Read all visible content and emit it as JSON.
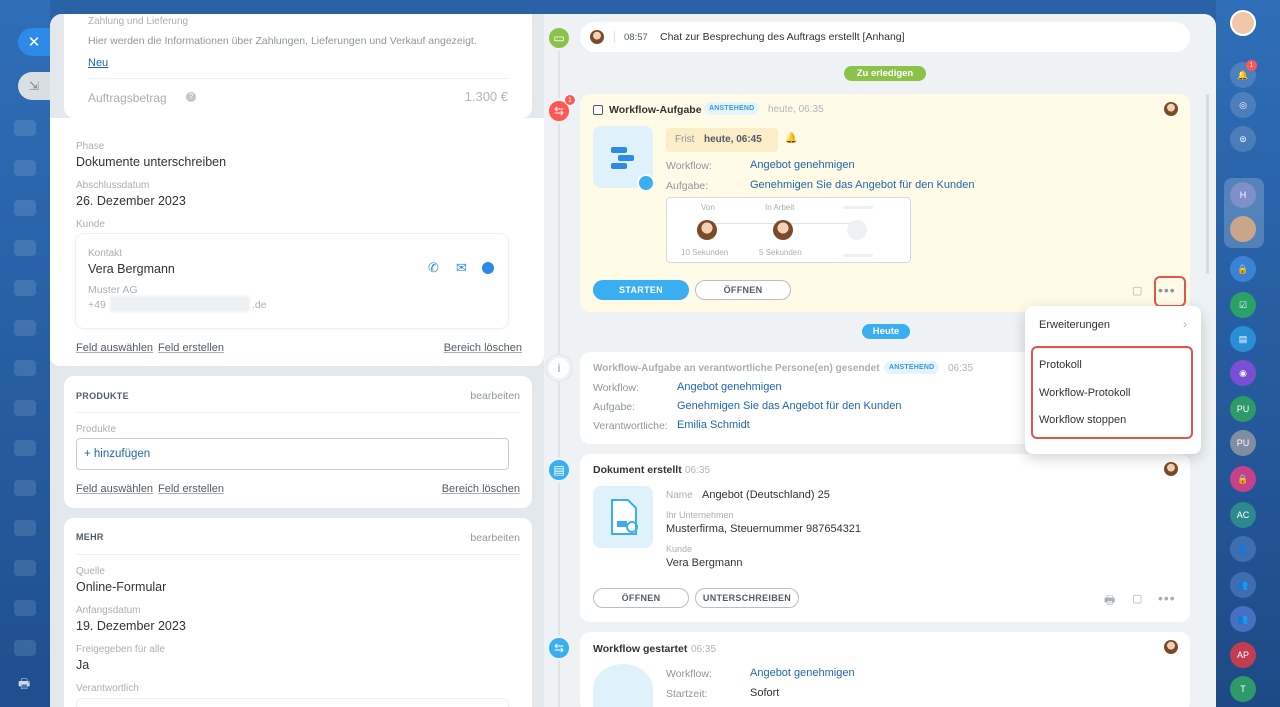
{
  "left_panel": {
    "payment": {
      "title": "Zahlung und Lieferung",
      "description": "Hier werden die Informationen über Zahlungen, Lieferungen und Verkauf angezeigt.",
      "new_link": "Neu",
      "amount_label": "Auftragsbetrag",
      "amount_value": "1.300 €"
    },
    "fields": {
      "phase_label": "Phase",
      "phase_value": "Dokumente unterschreiben",
      "close_date_label": "Abschlussdatum",
      "close_date_value": "26. Dezember 2023",
      "customer_label": "Kunde",
      "contact_label": "Kontakt",
      "contact_name": "Vera Bergmann",
      "company": "Muster AG",
      "phone_prefix": "+49",
      "email_suffix": ".de"
    },
    "actions": {
      "select_field": "Feld auswählen",
      "create_field": "Feld erstellen",
      "delete_section": "Bereich löschen"
    },
    "products": {
      "title": "PRODUKTE",
      "edit": "bearbeiten",
      "label": "Produkte",
      "add": "+ hinzufügen"
    },
    "more": {
      "title": "MEHR",
      "edit": "bearbeiten",
      "source_label": "Quelle",
      "source_value": "Online-Formular",
      "start_label": "Anfangsdatum",
      "start_value": "19. Dezember 2023",
      "shared_label": "Freigegeben für alle",
      "shared_value": "Ja",
      "responsible_label": "Verantwortlich"
    }
  },
  "timeline": {
    "chat": {
      "time": "08:57",
      "text": "Chat zur Besprechung des Auftrags erstellt [Anhang]"
    },
    "todo_pill": "Zu erledigen",
    "today_pill": "Heute",
    "workflow_task": {
      "badge_count": "1",
      "title": "Workflow-Aufgabe",
      "status": "ANSTEHEND",
      "time": "heute, 06:35",
      "deadline_label": "Frist",
      "deadline_value": "heute, 06:45",
      "workflow_label": "Workflow:",
      "workflow_value": "Angebot genehmigen",
      "task_label": "Aufgabe:",
      "task_value": "Genehmigen Sie das Angebot für den Kunden",
      "from_label": "Von",
      "in_progress_label": "In Arbeit",
      "from_time": "10 Sekunden",
      "progress_time": "5 Sekunden",
      "start_button": "STARTEN",
      "open_button": "ÖFFNEN"
    },
    "sent_task": {
      "title": "Workflow-Aufgabe an verantwortliche Persone(en) gesendet",
      "status": "ANSTEHEND",
      "time": "06:35",
      "workflow_label": "Workflow:",
      "workflow_value": "Angebot genehmigen",
      "task_label": "Aufgabe:",
      "task_value": "Genehmigen Sie das Angebot für den Kunden",
      "responsible_label": "Verantwortliche:",
      "responsible_value": "Emilia Schmidt"
    },
    "document": {
      "title": "Dokument erstellt",
      "time": "06:35",
      "name_label": "Name",
      "name_value": "Angebot (Deutschland) 25",
      "company_label": "Ihr Unternehmen",
      "company_value": "Musterfirma, Steuernummer 987654321",
      "customer_label": "Kunde",
      "customer_value": "Vera Bergmann",
      "open_button": "ÖFFNEN",
      "sign_button": "UNTERSCHREIBEN"
    },
    "workflow_started": {
      "title": "Workflow gestartet",
      "time": "06:35",
      "workflow_label": "Workflow:",
      "workflow_value": "Angebot genehmigen",
      "start_label": "Startzeit:",
      "start_value": "Sofort"
    }
  },
  "context_menu": {
    "extensions": "Erweiterungen",
    "protocol": "Protokoll",
    "workflow_protocol": "Workflow-Protokoll",
    "workflow_stop": "Workflow stoppen"
  },
  "sidebar_right": {
    "notification_count": "1",
    "avatars": [
      "H",
      "PU",
      "PU",
      "AC",
      "AP",
      "T"
    ]
  },
  "colors": {
    "accent": "#2d8ae6",
    "green": "#8bc34a",
    "task_bg": "#fffbe6",
    "highlight": "#e0564f"
  }
}
